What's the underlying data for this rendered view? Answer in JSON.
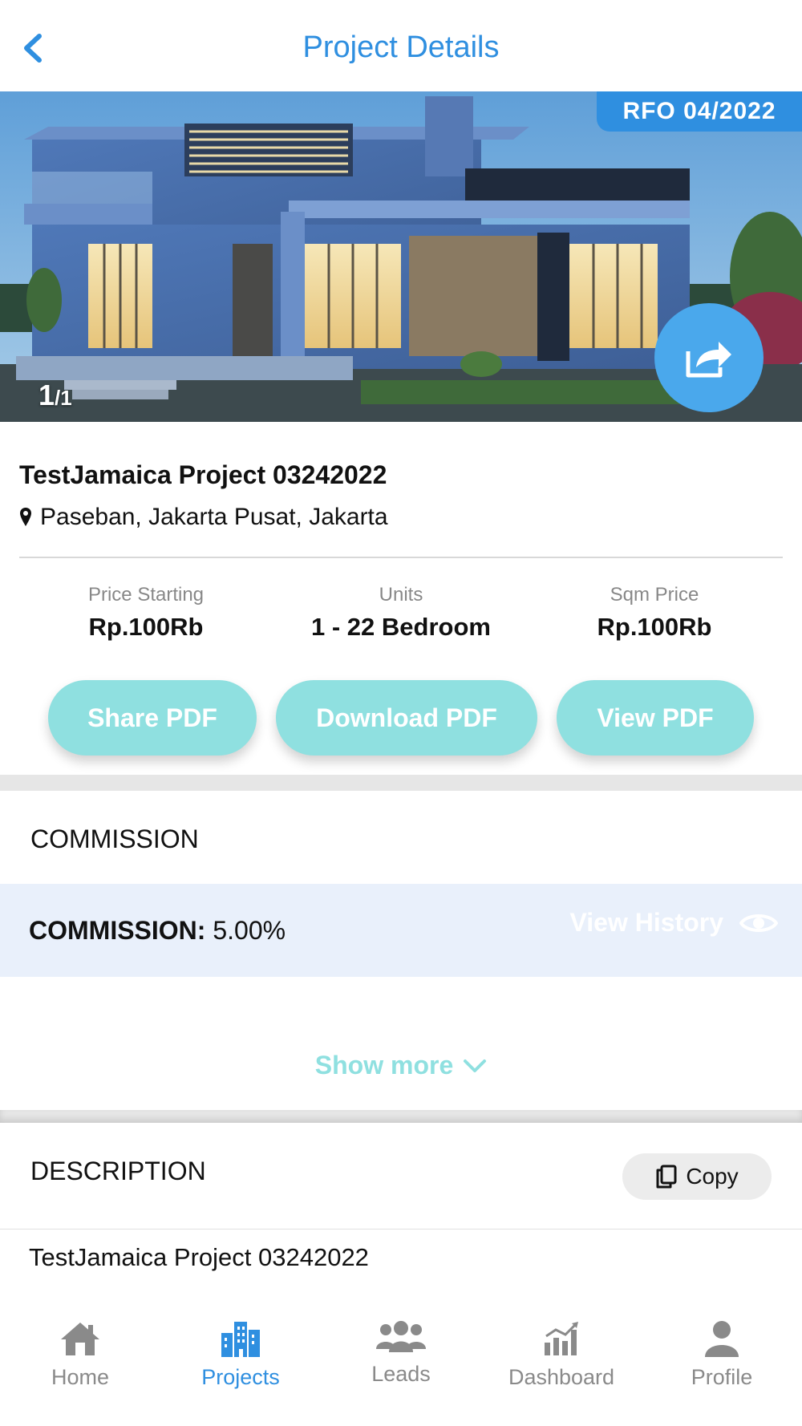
{
  "header": {
    "title": "Project Details"
  },
  "hero": {
    "badge": "RFO 04/2022",
    "counter_current": "1",
    "counter_total": "/1"
  },
  "project": {
    "name": "TestJamaica Project 03242022",
    "location": "Paseban, Jakarta Pusat, Jakarta"
  },
  "stats": [
    {
      "label": "Price Starting",
      "value": "Rp.100Rb"
    },
    {
      "label": "Units",
      "value": "1 - 22 Bedroom"
    },
    {
      "label": "Sqm Price",
      "value": "Rp.100Rb"
    }
  ],
  "actions": {
    "share_pdf": "Share PDF",
    "download_pdf": "Download PDF",
    "view_pdf": "View PDF"
  },
  "commission": {
    "heading": "COMMISSION",
    "label": "COMMISSION:",
    "value": "5.00%",
    "view_history": "View History",
    "show_more": "Show more"
  },
  "description": {
    "heading": "DESCRIPTION",
    "copy_label": "Copy",
    "text": "TestJamaica Project 03242022"
  },
  "tabbar": {
    "items": [
      {
        "label": "Home",
        "icon": "home-icon"
      },
      {
        "label": "Projects",
        "icon": "buildings-icon",
        "active": true
      },
      {
        "label": "Leads",
        "icon": "people-icon"
      },
      {
        "label": "Dashboard",
        "icon": "chart-icon"
      },
      {
        "label": "Profile",
        "icon": "person-icon"
      }
    ]
  },
  "colors": {
    "accent": "#2f8fe0",
    "teal": "#8fe0e0",
    "commission_bg": "#e9f0fb",
    "inactive": "#8a8a8a"
  }
}
